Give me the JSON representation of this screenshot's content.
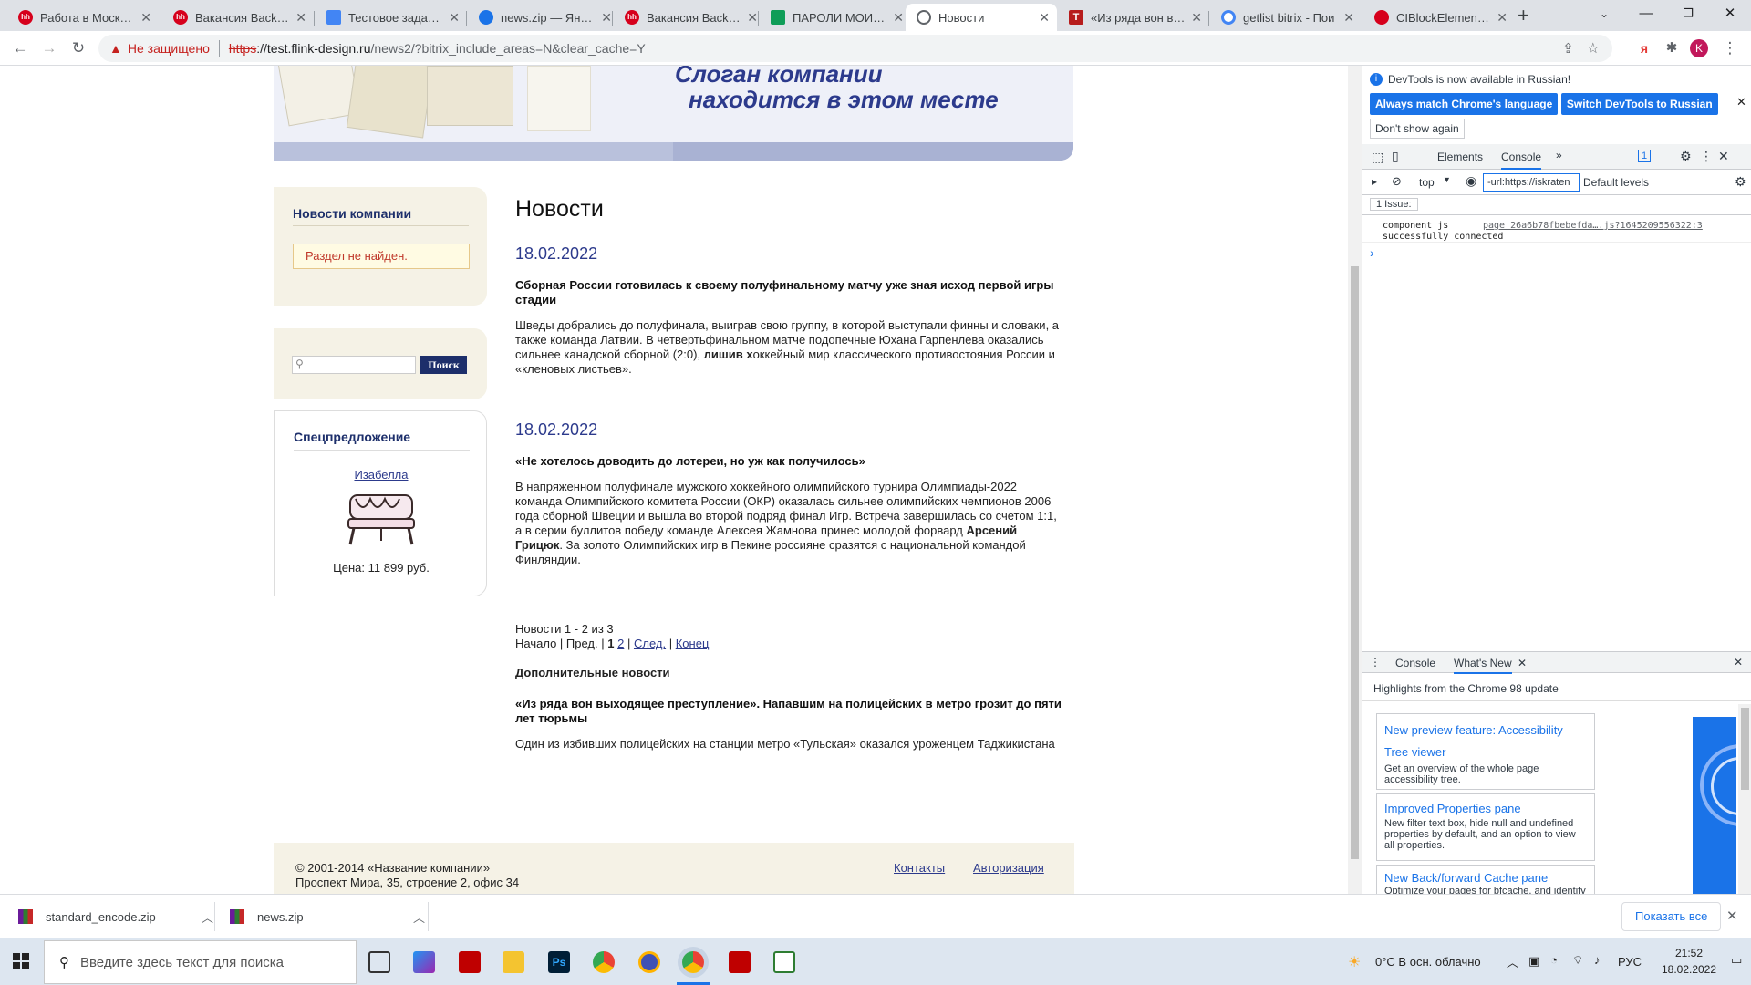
{
  "browser": {
    "tabs": [
      {
        "title": "Работа в Москве, "
      },
      {
        "title": "Вакансия Backend"
      },
      {
        "title": "Тестовое задание"
      },
      {
        "title": "news.zip — Яндекс"
      },
      {
        "title": "Вакансия Backend"
      },
      {
        "title": "ПАРОЛИ МОИ - G"
      },
      {
        "title": "Новости"
      },
      {
        "title": "«Из ряда вон вых"
      },
      {
        "title": "getlist bitrix - Пои"
      },
      {
        "title": "CIBlockElement::Ge"
      }
    ],
    "new_tab": "+",
    "security_label": "Не защищено",
    "url_scheme": "https",
    "url_host": "://test.flink-design.ru",
    "url_path": "/news2/?bitrix_include_areas=N&clear_cache=Y",
    "profile_initial": "K",
    "ya_label": "я"
  },
  "site": {
    "slogan_line1": "Слоган компании",
    "slogan_line2": "находится в этом месте",
    "sidebar": {
      "news_title": "Новости компании",
      "not_found": "Раздел не найден.",
      "search_button": "Поиск",
      "offer_title": "Спецпредложение",
      "offer_link": "Изабелла",
      "offer_price": "Цена: 11 899 руб."
    },
    "main": {
      "heading": "Новости",
      "news": [
        {
          "date": "18.02.2022",
          "title": "Сборная России готовилась к своему полуфинальному матчу уже зная исход первой игры стадии",
          "body_pre": "Шведы добрались до полуфинала, выиграв свою группу, в которой выступали финны и словаки, а также команда Латвии. В четвертьфинальном матче подопечные Юхана Гарпенлева оказались сильнее канадской сборной (2:0), ",
          "body_bold": "лишив х",
          "body_post": "оккейный мир классического противостояния России и «кленовых листьев»."
        },
        {
          "date": "18.02.2022",
          "title": "«Не хотелось доводить до лотереи, но уж как получилось»",
          "body_pre": "В напряженном полуфинале мужского хоккейного олимпийского турнира Олимпиады-2022 команда Олимпийского комитета России (ОКР) оказалась сильнее олимпийских чемпионов 2006 года сборной Швеции и вышла во второй подряд финал Игр. Встреча завершилась со счетом 1:1, а в серии буллитов победу команде Алексея Жамнова принес молодой форвард ",
          "body_bold": "Арсений Грицюк",
          "body_post": ". За золото Олимпийских игр в Пекине россияне сразятся с национальной командой Финляндии."
        }
      ],
      "pager_count": "Новости 1 - 2 из 3",
      "pager_start": "Начало | Пред. |",
      "pager_page1": "1",
      "pager_page2": "2",
      "pager_sep": "|",
      "pager_next": "След.",
      "pager_end": "Конец",
      "extra_heading": "Дополнительные новости",
      "extra_title": "«Из ряда вон выходящее преступление». Напавшим на полицейских в метро грозит до пяти лет тюрьмы",
      "extra_body": "Один из избивших полицейских на станции метро «Тульская» оказался уроженцем Таджикистана"
    },
    "footer": {
      "copyright": "© 2001-2014 «Название компании»",
      "address": "Проспект Мира, 35, строение 2, офис 34",
      "contacts": "Контакты",
      "auth": "Авторизация"
    }
  },
  "devtools": {
    "notice": "DevTools is now available in Russian!",
    "btn_match": "Always match Chrome's language",
    "btn_switch": "Switch DevTools to Russian",
    "dont_show": "Don't show again",
    "tab_elements": "Elements",
    "tab_console": "Console",
    "issues_count": "1",
    "context": "top",
    "filter_value": "-url:https://iskraten",
    "levels": "Default levels",
    "issues_label": "1 Issue:",
    "log_text1": "component js",
    "log_text2": "successfully connected",
    "log_source": "page 26a6b78fbebefda….js?1645209556322:3",
    "prompt": "›",
    "drawer_console": "Console",
    "drawer_whatsnew": "What's New",
    "highlights": "Highlights from the Chrome 98 update",
    "cards": [
      {
        "title": "New preview feature: Accessibility Tree viewer",
        "desc": "Get an overview of the whole page accessibility tree."
      },
      {
        "title": "Improved Properties pane",
        "desc": "New filter text box, hide null and undefined properties by default, and an option to view all properties."
      },
      {
        "title": "New Back/forward Cache pane",
        "desc": "Optimize your pages for bfcache, and identify"
      }
    ]
  },
  "downloads": {
    "items": [
      {
        "name": "standard_encode.zip"
      },
      {
        "name": "news.zip"
      }
    ],
    "show_all": "Показать все"
  },
  "taskbar": {
    "search_placeholder": "Введите здесь текст для поиска",
    "weather": "0°C  В осн. облачно",
    "lang": "РУС",
    "time": "21:52",
    "date": "18.02.2022"
  },
  "colors": {
    "accent": "#1a73e8",
    "site_blue": "#2c3a8c",
    "insecure": "#c5221f"
  }
}
